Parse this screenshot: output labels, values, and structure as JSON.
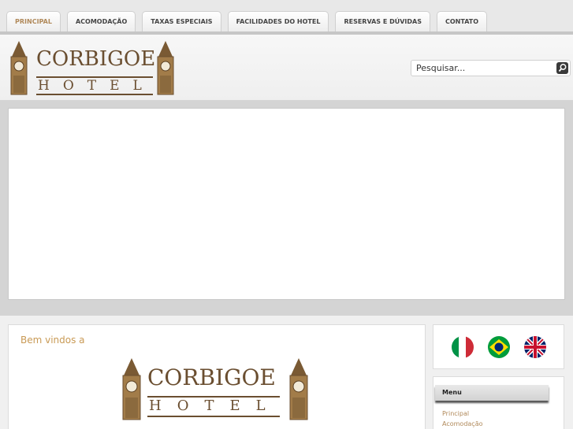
{
  "nav": {
    "tabs": [
      {
        "label": "Principal",
        "active": true
      },
      {
        "label": "Acomodação",
        "active": false
      },
      {
        "label": "Taxas Especiais",
        "active": false
      },
      {
        "label": "Facilidades do Hotel",
        "active": false
      },
      {
        "label": "Reservas e Dúvidas",
        "active": false
      },
      {
        "label": "Contato",
        "active": false
      }
    ]
  },
  "logo": {
    "word1": "CORBIGOE",
    "word2": "HOTEL"
  },
  "search": {
    "placeholder": "Pesquisar..."
  },
  "main": {
    "welcome": "Bem vindos a"
  },
  "flags": [
    {
      "icon": "italy-flag-icon",
      "colors": [
        "#009246",
        "#ffffff",
        "#ce2b37"
      ]
    },
    {
      "icon": "brazil-flag-icon",
      "colors": [
        "#009c3b",
        "#ffdf00",
        "#002776"
      ]
    },
    {
      "icon": "uk-flag-icon",
      "colors": [
        "#012169",
        "#ffffff",
        "#c8102e"
      ]
    }
  ],
  "menu": {
    "title": "Menu",
    "items": [
      "Principal",
      "Acomodação"
    ]
  },
  "colors": {
    "accent": "#b0895a",
    "welcome": "#c99a55",
    "logo": "#6a4e30"
  }
}
